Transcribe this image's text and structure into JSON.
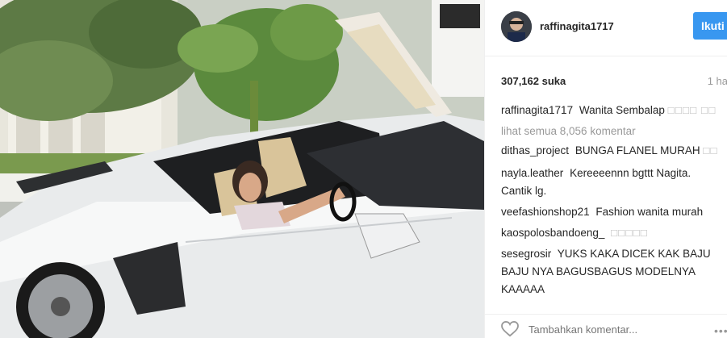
{
  "post": {
    "username": "raffinagita1717",
    "follow_label": "Ikuti",
    "likes": "307,162 suka",
    "time": "1 ha",
    "caption": {
      "user": "raffinagita1717",
      "text": "Wanita Sembalap",
      "emoji": "□□□□ □□"
    },
    "view_all": "lihat semua 8,056 komentar",
    "comments": [
      {
        "user": "dithas_project",
        "text": "BUNGA FLANEL MURAH",
        "emoji": "□□"
      },
      {
        "user": "nayla.leather",
        "text": "Kereeeennn bgttt Nagita. Cantik lg.",
        "emoji": ""
      },
      {
        "user": "veefashionshop21",
        "text": "Fashion wanita murah",
        "emoji": ""
      },
      {
        "user": "kaospolosbandoeng_",
        "text": "",
        "emoji": "□□□□□"
      },
      {
        "user": "sesegrosir",
        "text": "YUKS KAKA DICEK KAK BAJU BAJU NYA BAGUSBAGUS MODELNYA KAAAAA",
        "emoji": ""
      }
    ],
    "add_comment_placeholder": "Tambahkan komentar...",
    "more_icon": "•••"
  },
  "colors": {
    "follow_bg": "#3897f0",
    "muted": "#999999",
    "border": "#efefef"
  }
}
